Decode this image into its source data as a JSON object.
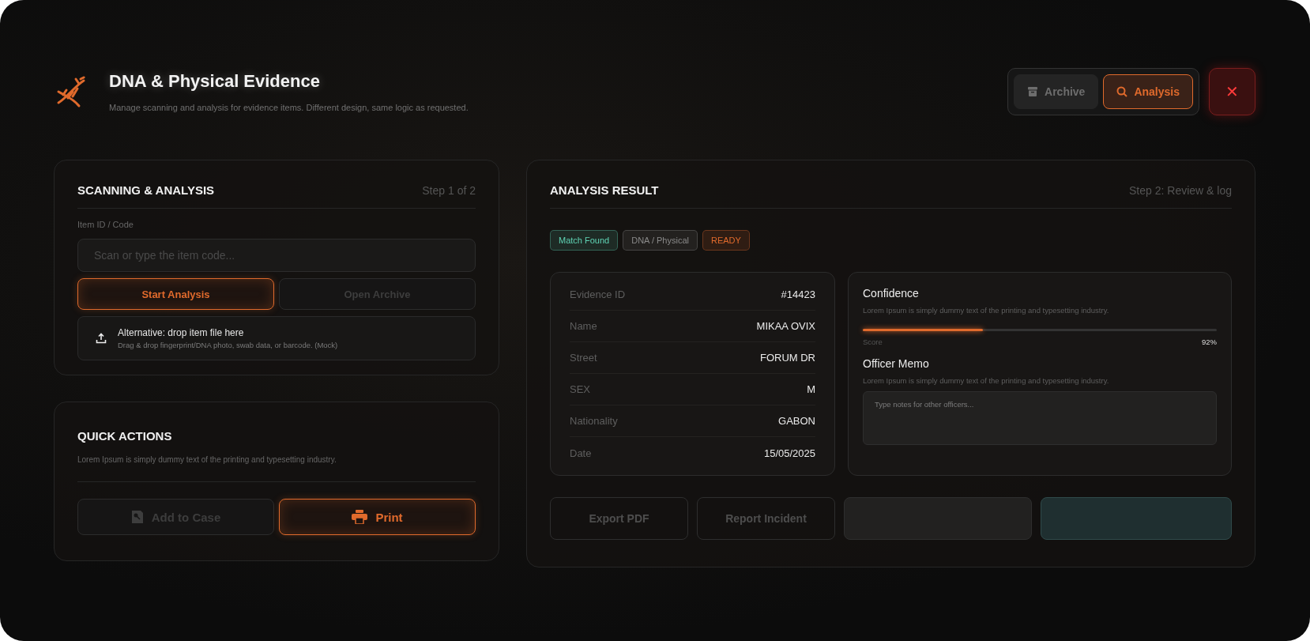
{
  "header": {
    "title": "DNA & Physical Evidence",
    "subtitle": "Manage scanning and analysis for evidence items. Different design, same logic as requested."
  },
  "nav_tabs": [
    {
      "label": "Archive",
      "kind": "archive",
      "selected": false
    },
    {
      "label": "Analysis",
      "kind": "search",
      "selected": true
    }
  ],
  "close_button": {
    "label": "✕"
  },
  "scanning": {
    "title": "SCANNING & ANALYSIS",
    "step": "Step 1 of 2",
    "field_label": "Item ID / Code",
    "placeholder": "Scan or type the item code...",
    "buttons": [
      {
        "label": "Start Analysis",
        "kind": "primary"
      },
      {
        "label": "Open Archive",
        "kind": "muted"
      }
    ],
    "drop": {
      "title": "Alternative: drop item file here",
      "hint": "Drag & drop fingerprint/DNA photo, swab data, or barcode. (Mock)"
    }
  },
  "quick_actions": {
    "title": "QUICK ACTIONS",
    "description": "Lorem Ipsum is simply dummy text of the printing and typesetting industry.",
    "buttons": [
      {
        "label": "Add to Case",
        "kind": "muted"
      },
      {
        "label": "Print",
        "kind": "primary"
      }
    ]
  },
  "result": {
    "title": "ANALYSIS RESULT",
    "step": "Step 2: Review & log",
    "badges": [
      {
        "label": "Match Found",
        "color": "#5fd3b4"
      },
      {
        "label": "DNA / Physical",
        "color": "#8a8a8a"
      },
      {
        "label": "READY",
        "color": "#e06a2c"
      }
    ],
    "fields": [
      {
        "label": "Evidence ID",
        "value": "#14423"
      },
      {
        "label": "Name",
        "value": "MIKAA OVIX"
      },
      {
        "label": "Street",
        "value": "FORUM DR"
      },
      {
        "label": "SEX",
        "value": "M"
      },
      {
        "label": "Nationality",
        "value": "GABON"
      },
      {
        "label": "Date",
        "value": "15/05/2025"
      }
    ],
    "confidence": {
      "title": "Confidence",
      "description": "Lorem Ipsum is simply dummy text of the printing and typesetting industry.",
      "level": 0.34,
      "score_label": "Score",
      "score": "92%"
    },
    "memo": {
      "title": "Officer Memo",
      "description": "Lorem Ipsum is simply dummy text of the printing and typesetting industry.",
      "placeholder": "Type notes for other officers..."
    },
    "actions": [
      {
        "label": "Export PDF",
        "kind": "outline"
      },
      {
        "label": "Report Incident",
        "kind": "outline"
      },
      {
        "kind": "blank"
      },
      {
        "kind": "teal"
      }
    ]
  }
}
